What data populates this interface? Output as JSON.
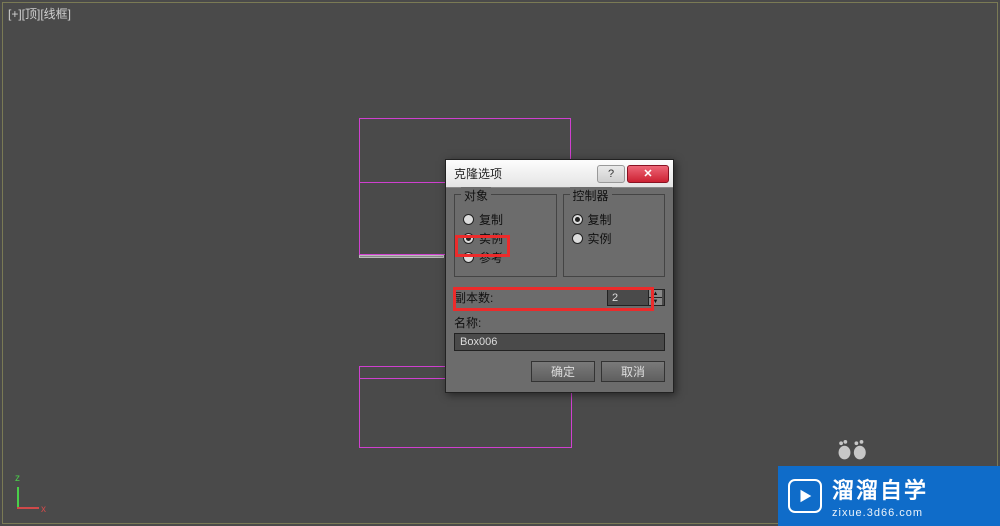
{
  "viewport": {
    "label": "[+][顶][线框]"
  },
  "axis": {
    "x": "x",
    "y": "z"
  },
  "dialog": {
    "title": "克隆选项",
    "help": "?",
    "close": "✕",
    "object_group": {
      "legend": "对象",
      "options": {
        "copy": "复制",
        "instance": "实例",
        "reference": "参考"
      },
      "selected": "instance"
    },
    "controller_group": {
      "legend": "控制器",
      "options": {
        "copy": "复制",
        "instance": "实例"
      },
      "selected": "copy"
    },
    "copies": {
      "label": "副本数:",
      "value": "2"
    },
    "name": {
      "label": "名称:",
      "value": "Box006"
    },
    "buttons": {
      "ok": "确定",
      "cancel": "取消"
    }
  },
  "watermark": {
    "brand": "溜溜自学",
    "url": "zixue.3d66.com"
  }
}
